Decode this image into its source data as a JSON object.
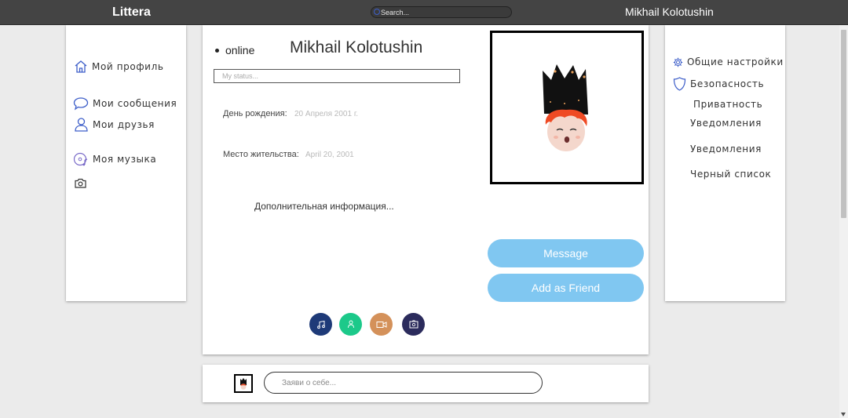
{
  "header": {
    "logo": "Littera",
    "search_placeholder": "Search...",
    "user_name": "Mikhail Kolotushin"
  },
  "left_nav": {
    "items": [
      {
        "label": "Мой профиль",
        "icon": "home-icon"
      },
      {
        "label": "Мои сообщения",
        "icon": "chat-bubble-icon"
      },
      {
        "label": "Мои друзья",
        "icon": "person-icon"
      },
      {
        "label": "Моя музыка",
        "icon": "music-disc-icon"
      },
      {
        "label": "",
        "icon": "camera-icon"
      }
    ]
  },
  "profile": {
    "status": "online",
    "name": "Mikhail Kolotushin",
    "status_placeholder": "My status...",
    "birthday_label": "День рождения:",
    "birthday_value": "20 Апреля 2001 г.",
    "residence_label": "Место жительства:",
    "residence_value": "April 20, 2001",
    "more_info": "Дополнительная информация...",
    "message_button": "Message",
    "add_friend_button": "Add as Friend"
  },
  "media_buttons": [
    {
      "icon": "music-note-icon",
      "color": "#1e3a78"
    },
    {
      "icon": "person-icon",
      "color": "#1cc98a"
    },
    {
      "icon": "video-icon",
      "color": "#d4915a"
    },
    {
      "icon": "photo-icon",
      "color": "#2b2b5c"
    }
  ],
  "settings": {
    "items": [
      {
        "label": "Общие настройки",
        "icon": "gear-icon"
      },
      {
        "label": "Безопасность",
        "icon": "shield-icon"
      },
      {
        "label": "Приватность"
      },
      {
        "label": "Уведомления"
      },
      {
        "label": "Уведомления"
      },
      {
        "label": "Черный список"
      }
    ]
  },
  "bottom": {
    "about_placeholder": "Заяви о себе..."
  },
  "colors": {
    "topbar": "#444444",
    "button": "#80c7f1",
    "nav_icon": "#3d5ec9"
  }
}
